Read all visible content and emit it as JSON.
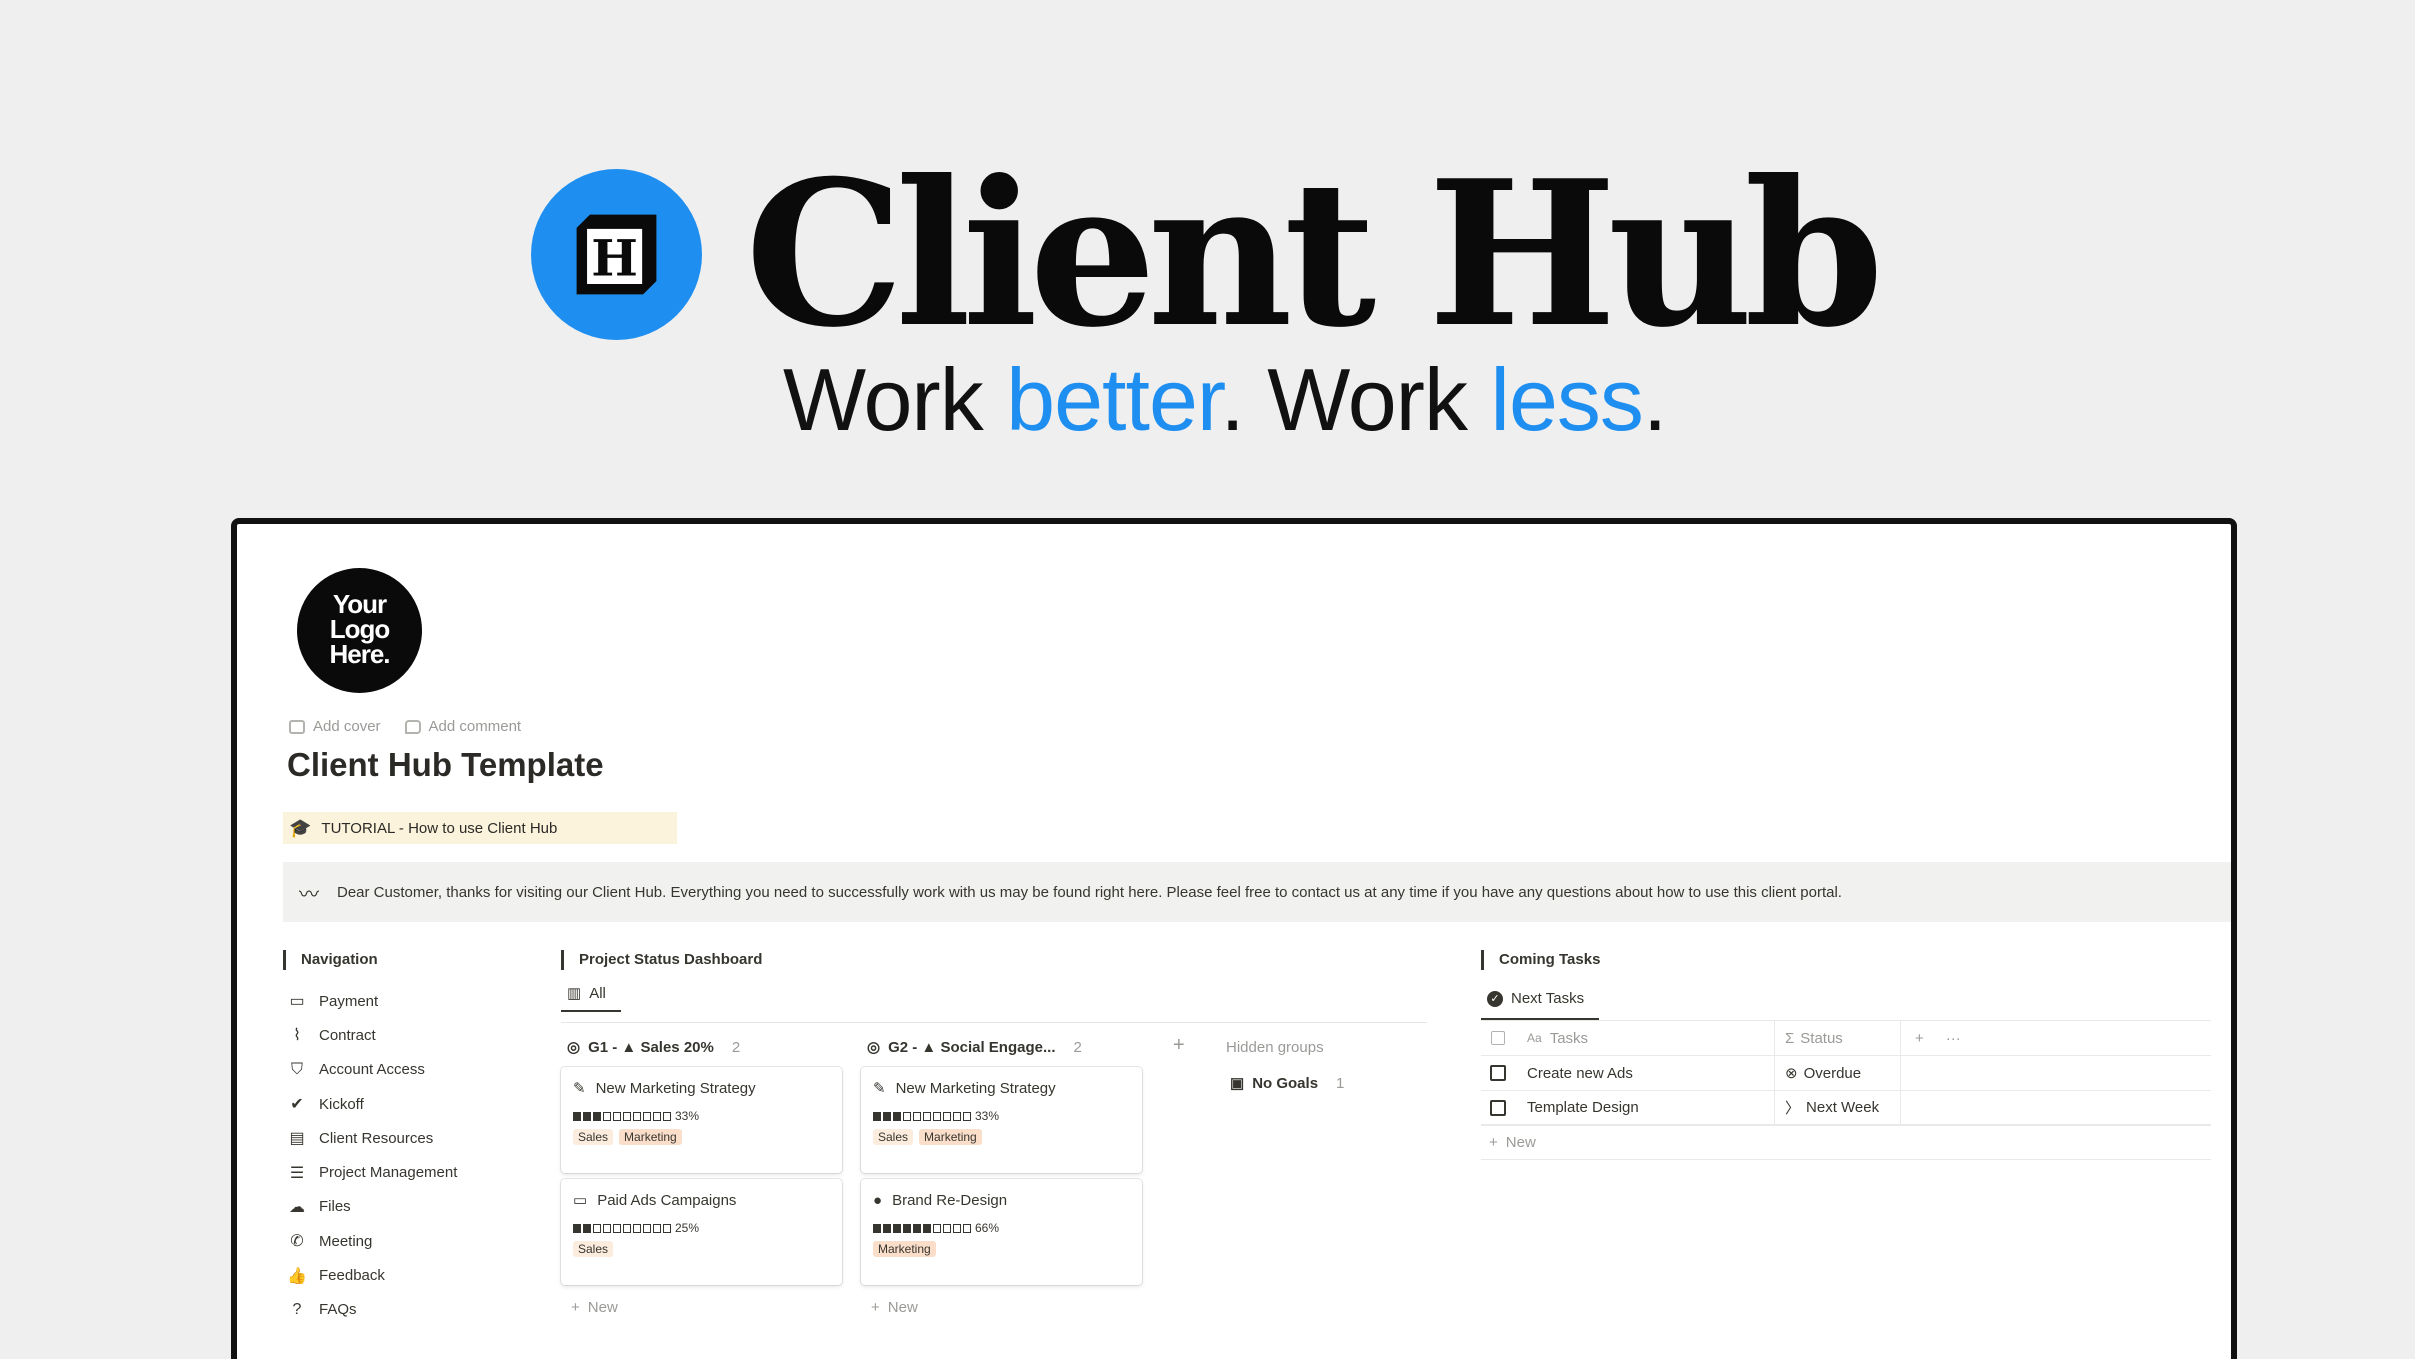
{
  "hero": {
    "title": "Client Hub",
    "logo_letter": "H",
    "tagline_parts": [
      "Work ",
      "better",
      ". Work ",
      "less",
      "."
    ]
  },
  "colors": {
    "accent": "#1e8ff0",
    "tutorial_bg": "#fbf3db",
    "callout_bg": "#f1f1ef",
    "tag_sales": "#fbecdd",
    "tag_marketing": "#fadec9"
  },
  "brand_logo": {
    "lines": [
      "Your",
      "Logo",
      "Here."
    ]
  },
  "page": {
    "add_cover": "Add cover",
    "add_comment": "Add comment",
    "title": "Client Hub Template",
    "tutorial": "TUTORIAL - How to use Client Hub",
    "callout": "Dear Customer, thanks for visiting our Client Hub. Everything you need to successfully work with us may be found right here. Please feel free to contact us at any time if you have any questions about how to use this client portal."
  },
  "navigation": {
    "heading": "Navigation",
    "items": [
      {
        "label": "Payment",
        "icon": "money-icon",
        "glyph": "▭"
      },
      {
        "label": "Contract",
        "icon": "paperclip-icon",
        "glyph": "⌇"
      },
      {
        "label": "Account Access",
        "icon": "shield-icon",
        "glyph": "⛉"
      },
      {
        "label": "Kickoff",
        "icon": "check-circle-icon",
        "glyph": "✔"
      },
      {
        "label": "Client Resources",
        "icon": "archive-icon",
        "glyph": "▤"
      },
      {
        "label": "Project Management",
        "icon": "list-icon",
        "glyph": "☰"
      },
      {
        "label": "Files",
        "icon": "cloud-upload-icon",
        "glyph": "☁"
      },
      {
        "label": "Meeting",
        "icon": "phone-icon",
        "glyph": "✆"
      },
      {
        "label": "Feedback",
        "icon": "thumbs-up-icon",
        "glyph": "👍"
      },
      {
        "label": "FAQs",
        "icon": "question-icon",
        "glyph": "?"
      }
    ]
  },
  "dashboard": {
    "heading": "Project Status Dashboard",
    "tab_all": "All",
    "groups": [
      {
        "title": "G1 - ▲ Sales 20%",
        "count": "2",
        "cards": [
          {
            "title": "New Marketing Strategy",
            "icon": "pin-icon",
            "glyph": "✎",
            "filled": 3,
            "total": 10,
            "percent": "33%",
            "tags": [
              "Sales",
              "Marketing"
            ]
          },
          {
            "title": "Paid Ads Campaigns",
            "icon": "money-icon",
            "glyph": "▭",
            "filled": 2,
            "total": 10,
            "percent": "25%",
            "tags": [
              "Sales"
            ]
          }
        ]
      },
      {
        "title": "G2 - ▲ Social Engage...",
        "count": "2",
        "cards": [
          {
            "title": "New Marketing Strategy",
            "icon": "pin-icon",
            "glyph": "✎",
            "filled": 3,
            "total": 10,
            "percent": "33%",
            "tags": [
              "Sales",
              "Marketing"
            ]
          },
          {
            "title": "Brand Re-Design",
            "icon": "apple-icon",
            "glyph": "●",
            "filled": 6,
            "total": 10,
            "percent": "66%",
            "tags": [
              "Marketing"
            ]
          }
        ]
      }
    ],
    "new_label": "New",
    "hidden_groups": "Hidden groups",
    "no_goals": "No Goals",
    "no_goals_count": "1"
  },
  "tasks": {
    "heading": "Coming Tasks",
    "view": "Next Tasks",
    "col_tasks": "Tasks",
    "col_tasks_prefix": "Aa",
    "col_status": "Status",
    "col_status_prefix": "Σ",
    "rows": [
      {
        "task": "Create new Ads",
        "status": "Overdue",
        "status_glyph": "⊗"
      },
      {
        "task": "Template Design",
        "status": "Next Week",
        "status_glyph": "〉"
      }
    ],
    "new_label": "New"
  }
}
